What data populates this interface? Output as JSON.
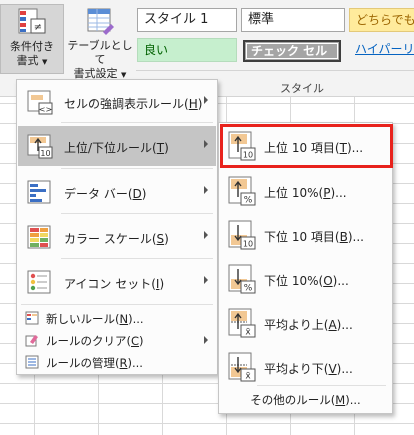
{
  "ribbon": {
    "conditional_formatting": {
      "line1": "条件付き",
      "line2": "書式"
    },
    "format_as_table": {
      "line1": "テーブルとして",
      "line2": "書式設定"
    },
    "styles": {
      "style1": "スタイル 1",
      "normal": "標準",
      "neutral": "どちらでも",
      "good": "良い",
      "check_cell": "チェック セル",
      "hyperlink": "ハイパーリ",
      "group_label": "スタイル"
    }
  },
  "menu": {
    "items": [
      {
        "label": "セルの強調表示ルール",
        "key": "H",
        "icon": "highlight-cells-rules-icon"
      },
      {
        "label": "上位/下位ルール",
        "key": "T",
        "icon": "top-bottom-rules-icon"
      },
      {
        "label": "データ バー",
        "key": "D",
        "icon": "data-bars-icon"
      },
      {
        "label": "カラー スケール",
        "key": "S",
        "icon": "color-scales-icon"
      },
      {
        "label": "アイコン セット",
        "key": "I",
        "icon": "icon-sets-icon"
      }
    ],
    "small": [
      {
        "label": "新しいルール",
        "key": "N",
        "suffix": "...",
        "icon": "new-rule-icon"
      },
      {
        "label": "ルールのクリア",
        "key": "C",
        "suffix": "",
        "icon": "clear-rules-icon"
      },
      {
        "label": "ルールの管理",
        "key": "R",
        "suffix": "...",
        "icon": "manage-rules-icon"
      }
    ]
  },
  "submenu": {
    "items": [
      {
        "label": "上位 10 項目",
        "key": "T",
        "suffix": "...",
        "icon": "top-10-items-icon",
        "badge": "10"
      },
      {
        "label": "上位 10%",
        "key": "P",
        "suffix": "...",
        "icon": "top-10-percent-icon",
        "badge": "%"
      },
      {
        "label": "下位 10 項目",
        "key": "B",
        "suffix": "...",
        "icon": "bottom-10-items-icon",
        "badge": "10"
      },
      {
        "label": "下位 10%",
        "key": "O",
        "suffix": "...",
        "icon": "bottom-10-percent-icon",
        "badge": "%"
      },
      {
        "label": "平均より上",
        "key": "A",
        "suffix": "...",
        "icon": "above-average-icon",
        "badge": "x̄"
      },
      {
        "label": "平均より下",
        "key": "V",
        "suffix": "...",
        "icon": "below-average-icon",
        "badge": "x̄"
      }
    ],
    "more": {
      "label": "その他のルール",
      "key": "M",
      "suffix": "..."
    }
  },
  "colors": {
    "highlight_border": "#e8221c",
    "active_item": "#c5c5c5"
  }
}
